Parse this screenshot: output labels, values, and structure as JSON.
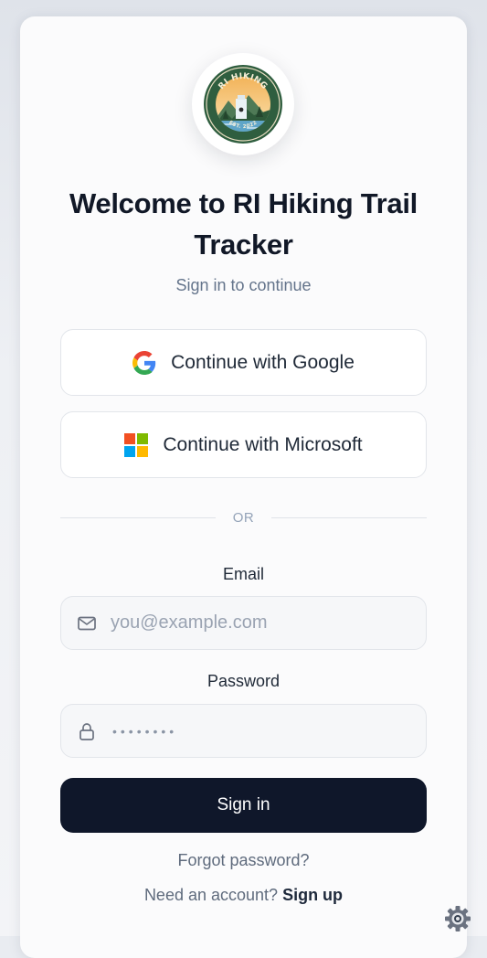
{
  "logo": {
    "top_text": "RI HIKING",
    "bottom_text": "EST. 2022",
    "icon": "ri-hiking-badge"
  },
  "header": {
    "title": "Welcome to RI Hiking Trail Tracker",
    "subtitle": "Sign in to continue"
  },
  "oauth": {
    "google_label": "Continue with Google",
    "google_icon": "google-icon",
    "microsoft_label": "Continue with Microsoft",
    "microsoft_icon": "microsoft-icon"
  },
  "divider": {
    "text": "OR"
  },
  "form": {
    "email_label": "Email",
    "email_placeholder": "you@example.com",
    "email_icon": "mail-icon",
    "password_label": "Password",
    "password_value": "••••••••",
    "password_icon": "lock-icon",
    "submit_label": "Sign in"
  },
  "footer": {
    "forgot_label": "Forgot password?",
    "signup_prompt": "Need an account?",
    "signup_label": "Sign up"
  },
  "colors": {
    "primary": "#0f172a",
    "text": "#111827",
    "muted": "#64748b",
    "border": "#e2e5ea",
    "badge_green": "#2f5e3f"
  }
}
